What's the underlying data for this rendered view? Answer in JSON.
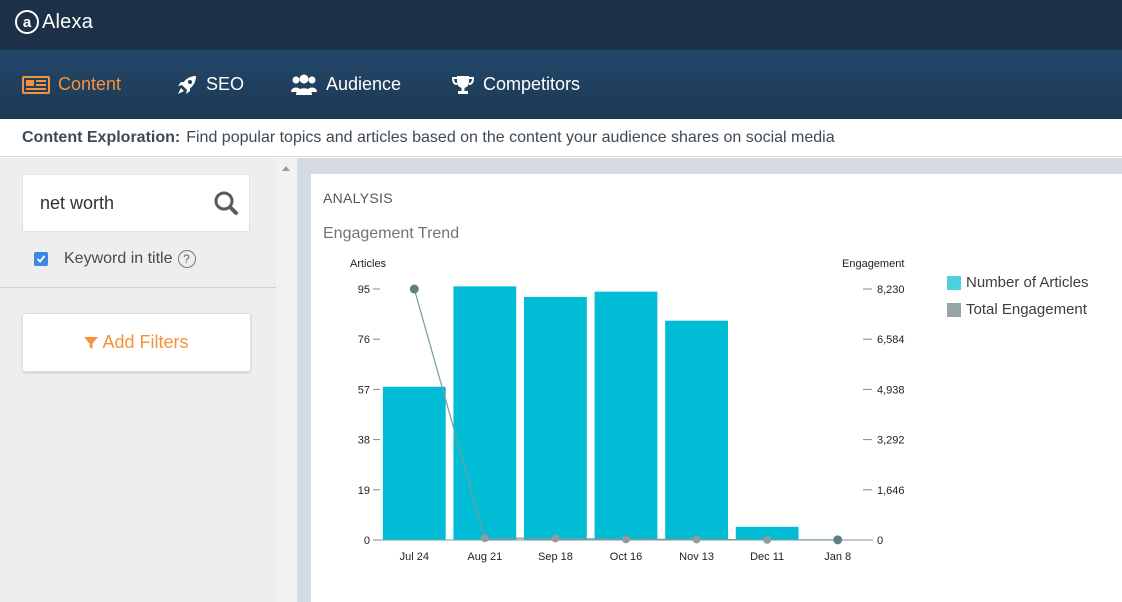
{
  "app": {
    "logo_letter": "a",
    "name": "Alexa"
  },
  "nav": {
    "items": [
      {
        "label": "Content",
        "icon": "newspaper-icon",
        "active": true
      },
      {
        "label": "SEO",
        "icon": "rocket-icon",
        "active": false
      },
      {
        "label": "Audience",
        "icon": "users-icon",
        "active": false
      },
      {
        "label": "Competitors",
        "icon": "trophy-icon",
        "active": false
      }
    ]
  },
  "subheader": {
    "lead": "Content Exploration:",
    "text": "Find popular topics and articles based on the content your audience shares on social media"
  },
  "sidebar": {
    "search_value": "net worth",
    "keyword_in_title_label": "Keyword in title",
    "keyword_in_title_checked": true,
    "help_glyph": "?",
    "add_filters_label": "Add Filters"
  },
  "main": {
    "section_label": "ANALYSIS",
    "chart_title": "Engagement Trend"
  },
  "colors": {
    "accent": "#f7923a",
    "bar": "#00bcd4",
    "line": "#7a9a9e",
    "nav_bg": "#1c3148"
  },
  "chart_data": {
    "type": "bar",
    "title": "Engagement Trend",
    "categories": [
      "Jul 24",
      "Aug 21",
      "Sep 18",
      "Oct 16",
      "Nov 13",
      "Dec 11",
      "Jan 8"
    ],
    "y_left_label": "Articles",
    "y_right_label": "Engagement",
    "y_left_ticks": [
      "0",
      "19",
      "38",
      "57",
      "76",
      "95"
    ],
    "y_right_ticks": [
      "0",
      "1,646",
      "3,292",
      "4,938",
      "6,584",
      "8,230"
    ],
    "y_left_range": [
      0,
      95
    ],
    "y_right_range": [
      0,
      8230
    ],
    "series": [
      {
        "name": "Number of Articles",
        "type": "bar",
        "axis": "left",
        "values": [
          58,
          96,
          92,
          94,
          83,
          5,
          0
        ]
      },
      {
        "name": "Total Engagement",
        "type": "line",
        "axis": "right",
        "values": [
          8230,
          60,
          55,
          25,
          20,
          5,
          5
        ]
      }
    ],
    "legend_position": "right"
  }
}
